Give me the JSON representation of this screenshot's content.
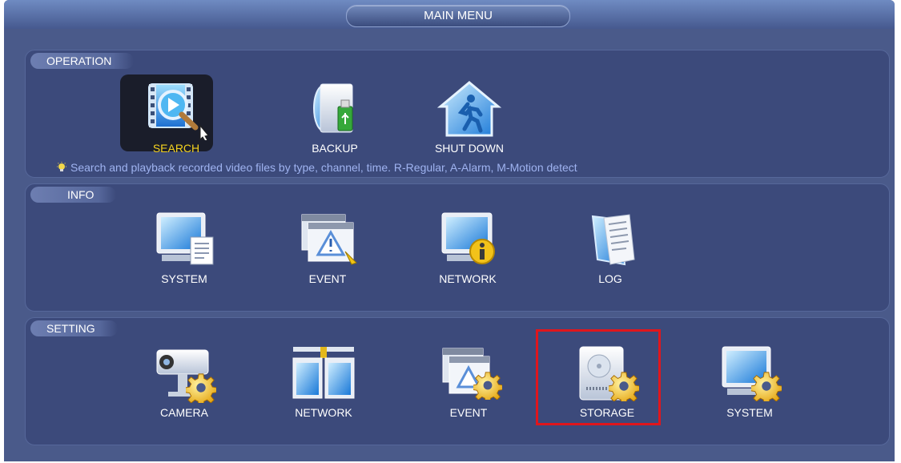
{
  "window": {
    "title": "MAIN MENU"
  },
  "operation": {
    "label": "OPERATION",
    "items": [
      {
        "label": "SEARCH",
        "icon": "search-film-icon",
        "selected": true
      },
      {
        "label": "BACKUP",
        "icon": "backup-disk-usb-icon"
      },
      {
        "label": "SHUT DOWN",
        "icon": "shutdown-house-icon"
      }
    ],
    "hint": "Search and playback recorded video files by type, channel, time. R-Regular, A-Alarm, M-Motion detect"
  },
  "info": {
    "label": "INFO",
    "items": [
      {
        "label": "SYSTEM",
        "icon": "monitor-document-icon"
      },
      {
        "label": "EVENT",
        "icon": "warning-windows-icon"
      },
      {
        "label": "NETWORK",
        "icon": "monitor-info-icon"
      },
      {
        "label": "LOG",
        "icon": "log-book-icon"
      }
    ]
  },
  "setting": {
    "label": "SETTING",
    "items": [
      {
        "label": "CAMERA",
        "icon": "camera-gear-icon"
      },
      {
        "label": "NETWORK",
        "icon": "network-gear-icon"
      },
      {
        "label": "EVENT",
        "icon": "event-gear-icon"
      },
      {
        "label": "STORAGE",
        "icon": "storage-gear-icon",
        "highlighted": true
      },
      {
        "label": "SYSTEM",
        "icon": "monitor-gear-icon"
      }
    ]
  },
  "colors": {
    "background": "#4a5a8a",
    "panel": "#3c4a7b",
    "selected_label": "#f4d21f",
    "hint_text": "#9fb3f0",
    "highlight_box": "#e0161c"
  }
}
